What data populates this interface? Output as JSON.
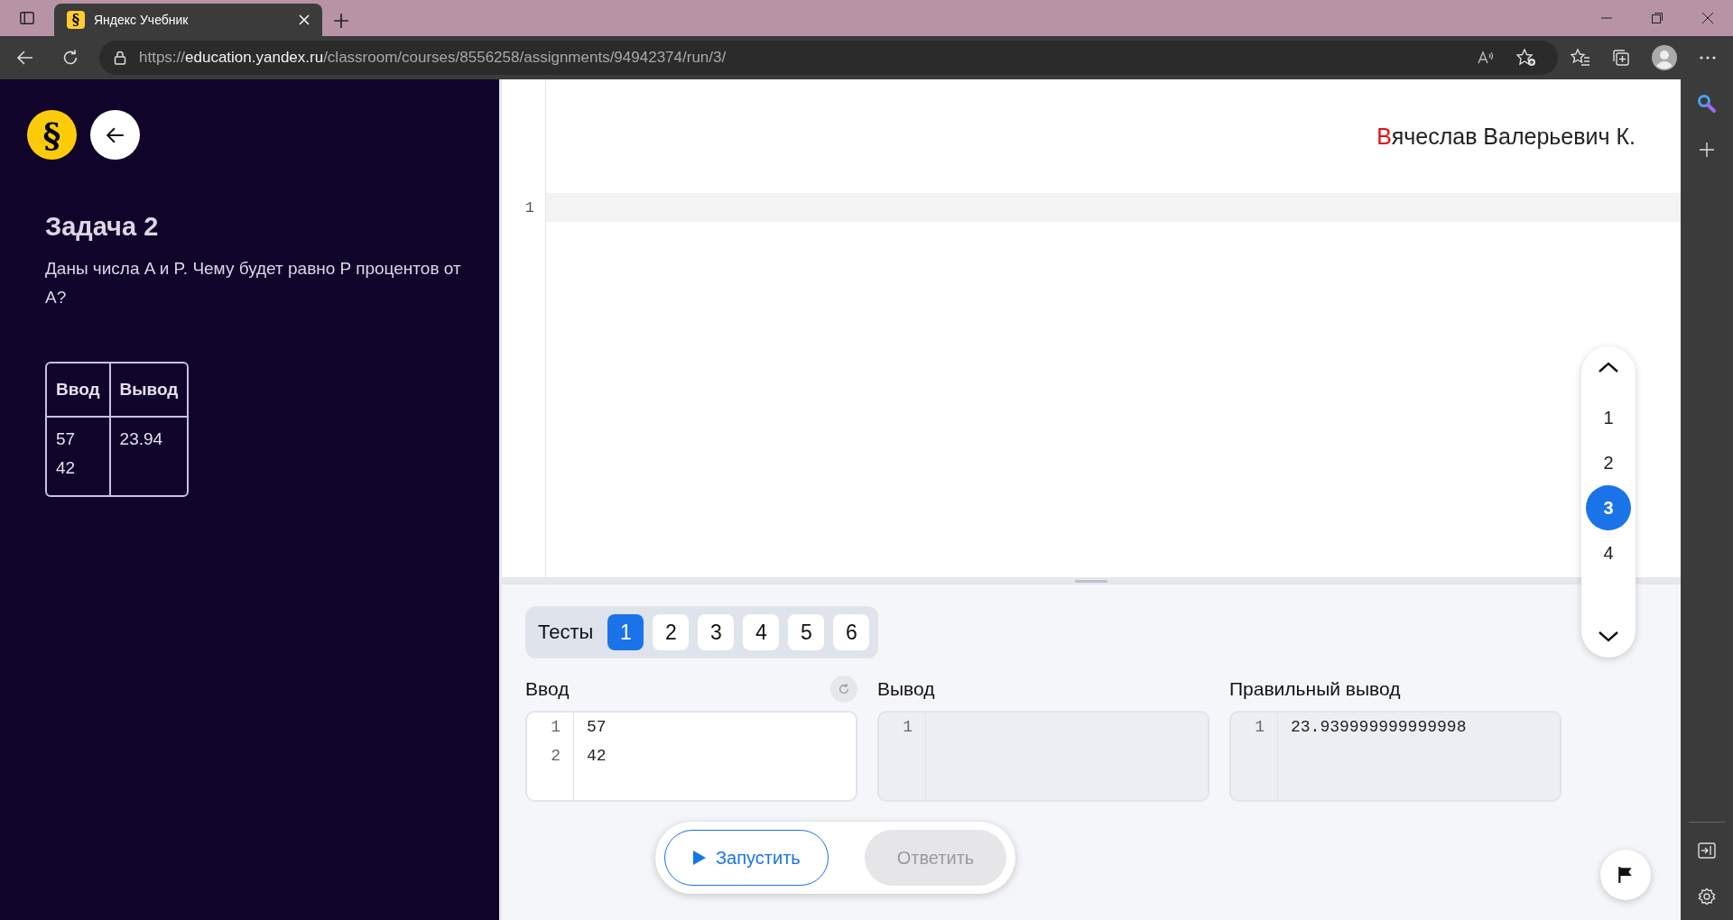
{
  "browser": {
    "tab": {
      "favicon": "§",
      "title": "Яндекс Учебник",
      "selected": true
    },
    "address": {
      "scheme": "https://",
      "host": "education.yandex.ru",
      "path": "/classroom/courses/8556258/assignments/94942374/run/3/"
    }
  },
  "task": {
    "logo": "§",
    "title": "Задача 2",
    "description": "Даны числа A и P. Чему будет равно P процентов от A?",
    "examples": {
      "columns": [
        "Ввод",
        "Вывод"
      ],
      "rows": [
        {
          "input": "57\n42",
          "output": "23.94"
        }
      ]
    }
  },
  "editor": {
    "author": "Вячеслав Валерьевич К.",
    "line_numbers": [
      "1"
    ]
  },
  "page_nav": [
    {
      "label": "1",
      "selected": false
    },
    {
      "label": "2",
      "selected": false
    },
    {
      "label": "3",
      "selected": true
    },
    {
      "label": "4",
      "selected": false
    }
  ],
  "tests": {
    "label": "Тесты",
    "items": [
      {
        "label": "1",
        "selected": true
      },
      {
        "label": "2",
        "selected": false
      },
      {
        "label": "3",
        "selected": false
      },
      {
        "label": "4",
        "selected": false
      },
      {
        "label": "5",
        "selected": false
      },
      {
        "label": "6",
        "selected": false
      }
    ]
  },
  "io": [
    {
      "title": "Ввод",
      "editable": true,
      "reset": true,
      "line_numbers": [
        "1",
        "2"
      ],
      "lines": [
        "57",
        "42"
      ]
    },
    {
      "title": "Вывод",
      "editable": false,
      "reset": false,
      "line_numbers": [
        "1"
      ]
    },
    {
      "title": "Правильный вывод",
      "editable": false,
      "reset": false,
      "line_numbers": [
        "1"
      ],
      "lines": [
        "23.939999999999998"
      ]
    }
  ],
  "actions": [
    {
      "label": "Запустить",
      "kind": "run",
      "disabled": false
    },
    {
      "label": "Ответить",
      "kind": "submit",
      "disabled": true
    }
  ]
}
